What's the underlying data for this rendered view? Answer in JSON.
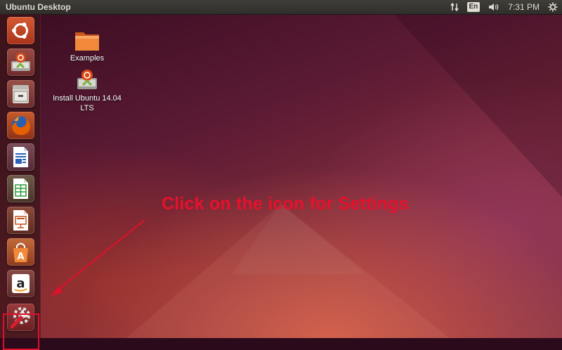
{
  "top_panel": {
    "title": "Ubuntu Desktop",
    "keyboard_layout": "En",
    "clock": "7:31 PM",
    "icons": [
      "network-transfer-icon",
      "volume-icon",
      "gear-icon"
    ]
  },
  "launcher": {
    "items": [
      {
        "name": "dash-home",
        "icon": "ubuntu-logo-icon"
      },
      {
        "name": "install-ubuntu",
        "icon": "installer-icon"
      },
      {
        "name": "files",
        "icon": "file-cabinet-icon"
      },
      {
        "name": "firefox",
        "icon": "firefox-icon"
      },
      {
        "name": "libreoffice-writer",
        "icon": "writer-document-icon"
      },
      {
        "name": "libreoffice-calc",
        "icon": "calc-spreadsheet-icon"
      },
      {
        "name": "libreoffice-impress",
        "icon": "impress-presentation-icon"
      },
      {
        "name": "ubuntu-software-center",
        "icon": "shopping-bag-icon"
      },
      {
        "name": "amazon",
        "icon": "amazon-logo-icon"
      },
      {
        "name": "system-settings",
        "icon": "settings-wrench-icon",
        "highlighted": true
      }
    ]
  },
  "desktop": {
    "icons": [
      {
        "label": "Examples",
        "icon": "folder-icon"
      },
      {
        "label_line1": "Install Ubuntu 14.04",
        "label_line2": "LTS",
        "icon": "installer-icon"
      }
    ]
  },
  "annotation": {
    "text": "Click on the icon for Settings",
    "color": "#e8102c"
  },
  "colors": {
    "panel": "#3a3935",
    "annotation_red": "#e0102a",
    "firefox_orange": "#e66000",
    "ubuntu_orange": "#dd4814"
  }
}
